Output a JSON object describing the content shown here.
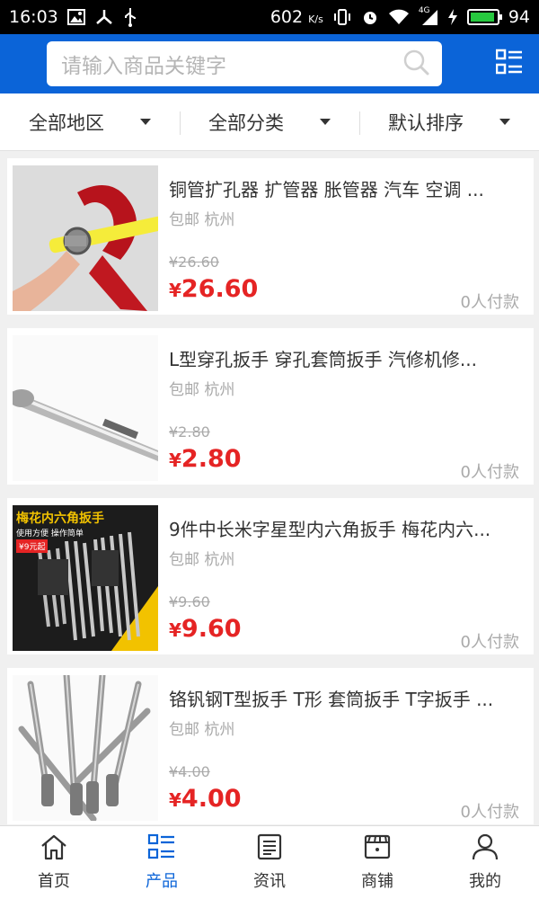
{
  "status_bar": {
    "time": "16:03",
    "speed": "602",
    "speed_unit": "K/s",
    "network": "4G",
    "battery": "94",
    "battery_level": 0.94
  },
  "search": {
    "placeholder": "请输入商品关键字"
  },
  "filters": [
    {
      "label": "全部地区"
    },
    {
      "label": "全部分类"
    },
    {
      "label": "默认排序"
    }
  ],
  "products": [
    {
      "title": "铜管扩孔器 扩管器 胀管器 汽车 空调 ...",
      "location": "包邮 杭州",
      "old_price": "¥26.60",
      "currency": "¥",
      "price": "26.60",
      "sold": "0人付款"
    },
    {
      "title": "L型穿孔扳手 穿孔套筒扳手 汽修机修...",
      "location": "包邮 杭州",
      "old_price": "¥2.80",
      "currency": "¥",
      "price": "2.80",
      "sold": "0人付款"
    },
    {
      "title": "9件中长米字星型内六角扳手 梅花内六...",
      "location": "包邮 杭州",
      "old_price": "¥9.60",
      "currency": "¥",
      "price": "9.60",
      "sold": "0人付款",
      "image_text": {
        "headline": "梅花内六角扳手",
        "sub": "使用方便 操作简单",
        "badge": "¥9元起"
      }
    },
    {
      "title": "铬钒钢T型扳手 T形 套筒扳手 T字扳手 ...",
      "location": "包邮 杭州",
      "old_price": "¥4.00",
      "currency": "¥",
      "price": "4.00",
      "sold": "0人付款"
    }
  ],
  "nav": [
    {
      "label": "首页",
      "icon": "home-icon"
    },
    {
      "label": "产品",
      "icon": "product-list-icon"
    },
    {
      "label": "资讯",
      "icon": "news-icon"
    },
    {
      "label": "商铺",
      "icon": "shop-icon"
    },
    {
      "label": "我的",
      "icon": "user-icon"
    }
  ],
  "colors": {
    "brand_blue": "#0b64d8",
    "price_red": "#e52424",
    "battery_green": "#27c93f"
  }
}
